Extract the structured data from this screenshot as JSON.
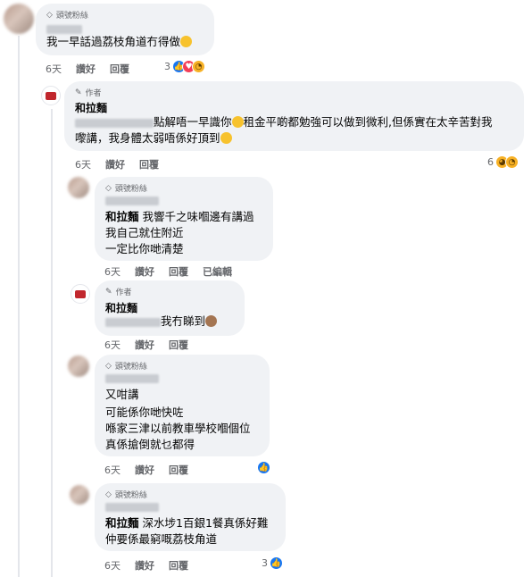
{
  "comments": [
    {
      "badge": "頭號粉絲",
      "text": "我一早話過荔枝角道冇得做",
      "time": "6天",
      "like": "讚好",
      "reply": "回覆",
      "reaction_count": "3",
      "reactions": [
        "like-icon",
        "love-icon",
        "sad-icon"
      ]
    },
    {
      "badge": "作者",
      "name": "和拉麵",
      "text_line1": "點解唔一早識你",
      "text_line1b": "租金平啲都勉強可以做到微利,但係實在太辛苦對我",
      "text_line2": "嚟講，我身體太弱唔係好頂到",
      "time": "6天",
      "like": "讚好",
      "reply": "回覆",
      "reaction_count": "6",
      "reactions": [
        "care-icon",
        "sad-icon"
      ]
    },
    {
      "badge": "頭號粉絲",
      "name": "和拉麵",
      "text_line1": "我響千之味嗰邊有講過",
      "text_line2": "我自己就住附近",
      "text_line3": "一定比你哋清楚",
      "time": "6天",
      "like": "讚好",
      "reply": "回覆",
      "edited": "已編輯"
    },
    {
      "badge": "作者",
      "name": "和拉麵",
      "text": "我冇睇到",
      "time": "6天",
      "like": "讚好",
      "reply": "回覆"
    },
    {
      "badge": "頭號粉絲",
      "text_line1": "又咁講",
      "text_line2": "可能係你哋快咗",
      "text_line3": "喺家三津以前教車學校嗰個位",
      "text_line4": "真係搶倒就乜都得",
      "time": "6天",
      "like": "讚好",
      "reply": "回覆",
      "reactions": [
        "like-icon"
      ]
    },
    {
      "badge": "頭號粉絲",
      "name": "和拉麵",
      "text_line1": "深水埗1百銀1餐真係好難",
      "text_line2": "仲要係最窮嘅荔枝角道",
      "time": "6天",
      "like": "讚好",
      "reply": "回覆",
      "reaction_count": "3",
      "reactions": [
        "like-icon"
      ]
    }
  ]
}
